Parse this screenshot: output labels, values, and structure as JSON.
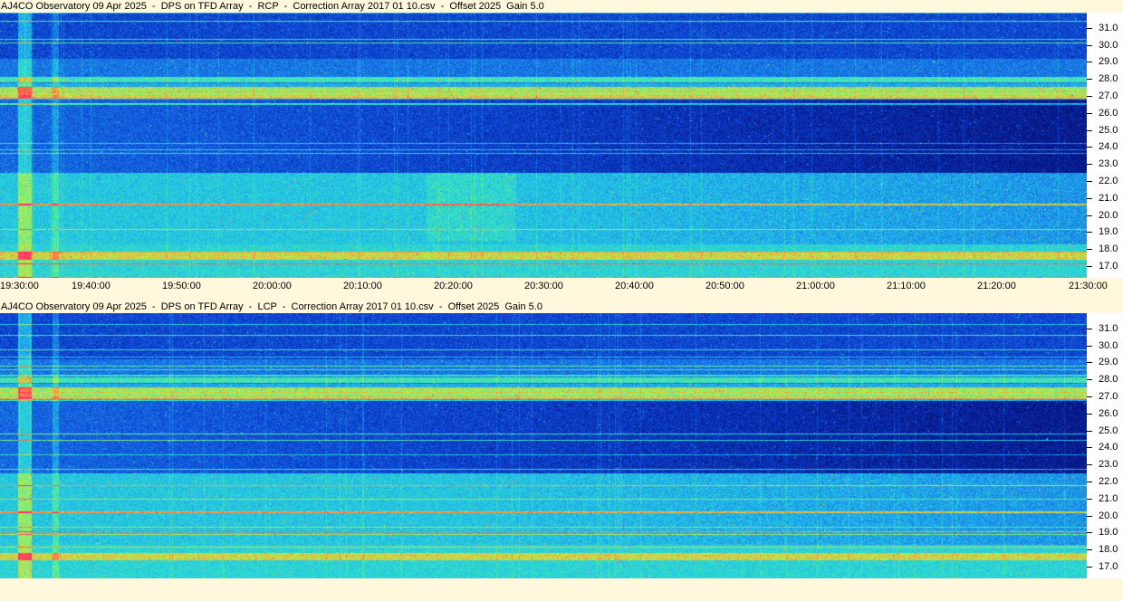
{
  "chart_data": [
    {
      "type": "heatmap",
      "title": "AJ4CO Observatory 09 Apr 2025  -  DPS on TFD Array  -  RCP  -  Correction Array 2017 01 10.csv  -  Offset 2025  Gain 5.0",
      "polarization": "RCP",
      "x_tick_labels": [
        "19:30:00",
        "19:40:00",
        "19:50:00",
        "20:00:00",
        "20:10:00",
        "20:20:00",
        "20:30:00",
        "20:40:00",
        "20:50:00",
        "21:00:00",
        "21:10:00",
        "21:20:00",
        "21:30:00"
      ],
      "y_tick_labels": [
        "31.0",
        "30.0",
        "29.0",
        "28.0",
        "27.0",
        "26.0",
        "25.0",
        "24.0",
        "23.0",
        "22.0",
        "21.0",
        "20.0",
        "19.0",
        "18.0",
        "17.0"
      ],
      "y_ticks": [
        31,
        30,
        29,
        28,
        27,
        26,
        25,
        24,
        23,
        22,
        21,
        20,
        19,
        18,
        17
      ],
      "ylim": [
        16.3,
        31.9
      ],
      "xlim": [
        "19:30:00",
        "21:30:00"
      ],
      "colormap": [
        "#06127a",
        "#0b3fd1",
        "#1a7be6",
        "#22c6e8",
        "#3ee8b0",
        "#b8f04a",
        "#ff8a3c",
        "#ff2b6e"
      ]
    },
    {
      "type": "heatmap",
      "title": "AJ4CO Observatory 09 Apr 2025  -  DPS on TFD Array  -  LCP  -  Correction Array 2017 01 10.csv  -  Offset 2025  Gain 5.0",
      "polarization": "LCP",
      "y_tick_labels": [
        "31.0",
        "30.0",
        "29.0",
        "28.0",
        "27.0",
        "26.0",
        "25.0",
        "24.0",
        "23.0",
        "22.0",
        "21.0",
        "20.0",
        "19.0",
        "18.0",
        "17.0"
      ],
      "y_ticks": [
        31,
        30,
        29,
        28,
        27,
        26,
        25,
        24,
        23,
        22,
        21,
        20,
        19,
        18,
        17
      ],
      "ylim": [
        16.3,
        31.9
      ],
      "xlim": [
        "19:30:00",
        "21:30:00"
      ],
      "colormap": [
        "#06127a",
        "#0b3fd1",
        "#1a7be6",
        "#22c6e8",
        "#3ee8b0",
        "#b8f04a",
        "#ff8a3c",
        "#ff2b6e"
      ]
    }
  ]
}
